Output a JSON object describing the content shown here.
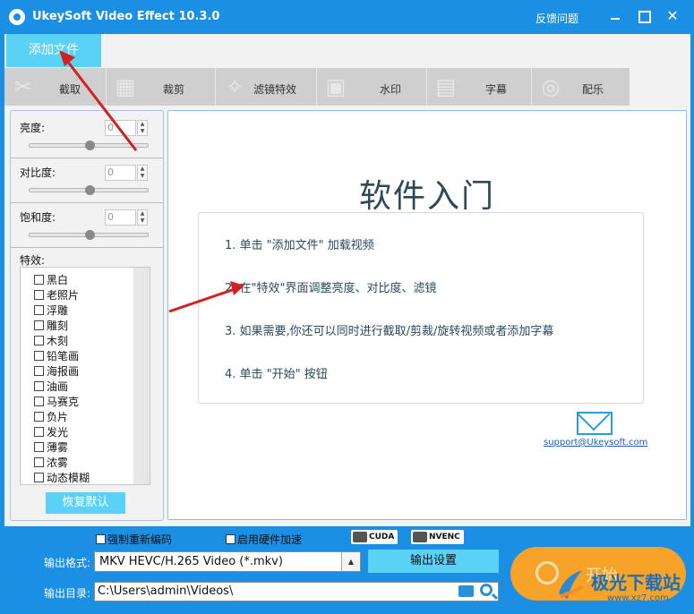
{
  "window": {
    "title": "UkeySoft Video Effect 10.3.0",
    "feedback": "反馈问题"
  },
  "toolbar": {
    "add_file": "添加文件",
    "tabs": [
      {
        "label": "截取",
        "icon": "scissors-icon"
      },
      {
        "label": "裁剪",
        "icon": "crop-icon"
      },
      {
        "label": "滤镜特效",
        "icon": "sparkle-icon"
      },
      {
        "label": "水印",
        "icon": "watermark-icon"
      },
      {
        "label": "字幕",
        "icon": "subtitle-icon"
      },
      {
        "label": "配乐",
        "icon": "music-icon"
      }
    ]
  },
  "left": {
    "brightness_label": "亮度:",
    "brightness_value": "0",
    "contrast_label": "对比度:",
    "contrast_value": "0",
    "saturation_label": "饱和度:",
    "saturation_value": "0",
    "effects_label": "特效:",
    "effects": [
      "黑白",
      "老照片",
      "浮雕",
      "雕刻",
      "木刻",
      "铅笔画",
      "海报画",
      "油画",
      "马赛克",
      "负片",
      "发光",
      "薄雾",
      "浓雾",
      "动态模糊"
    ],
    "reset": "恢复默认"
  },
  "guide": {
    "title": "软件入门",
    "steps": [
      "1. 单击 \"添加文件\" 加载视频",
      "2. 在\"特效\"界面调整亮度、对比度、滤镜",
      "3. 如果需要,你还可以同时进行截取/剪裁/旋转视频或者添加字幕",
      "4. 单击 \"开始\" 按钮"
    ],
    "support_email": "support@Ukeysoft.com"
  },
  "bottom": {
    "force_reencode": "强制重新编码",
    "hw_accel": "启用硬件加速",
    "cuda": "CUDA",
    "nvenc": "NVENC",
    "format_label": "输出格式:",
    "format_value": "MKV HEVC/H.265 Video (*.mkv)",
    "output_settings": "输出设置",
    "dir_label": "输出目录:",
    "dir_value": "C:\\Users\\admin\\Videos\\",
    "start": "开始"
  },
  "watermark": {
    "name": "极光下载站",
    "url": "www.xz7.com"
  }
}
